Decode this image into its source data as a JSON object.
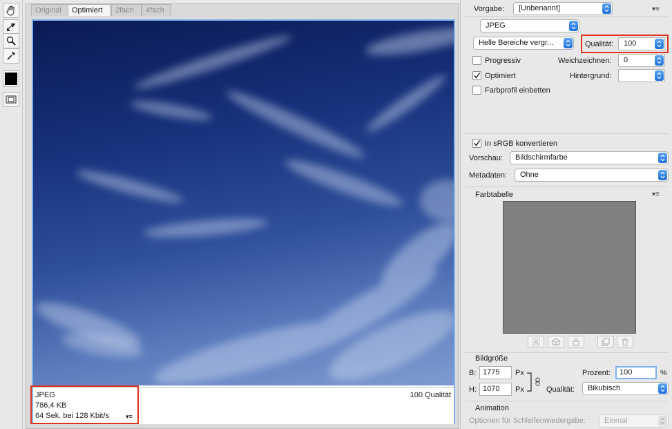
{
  "tabs": [
    "Original",
    "Optimiert",
    "2fach",
    "4fach"
  ],
  "info": {
    "format": "JPEG",
    "size": "786,4 KB",
    "download": "64 Sek. bei 128 Kbit/s",
    "quality": "100 Qualität"
  },
  "panel": {
    "vorgabe_label": "Vorgabe:",
    "vorgabe_value": "[Unbenannt]",
    "format_value": "JPEG",
    "preset_quality_value": "Helle Bereiche vergr...",
    "qualitaet_label": "Qualität:",
    "qualitaet_value": "100",
    "progressiv_label": "Progressiv",
    "optimiert_label": "Optimiert",
    "farbprofil_label": "Farbprofil einbetten",
    "weichzeichnen_label": "Weichzeichnen:",
    "weichzeichnen_value": "0",
    "hintergrund_label": "Hintergrund:",
    "hintergrund_value": "",
    "srgb_label": "In sRGB konvertieren",
    "vorschau_label": "Vorschau:",
    "vorschau_value": "Bildschirmfarbe",
    "metadaten_label": "Metadaten:",
    "metadaten_value": "Ohne",
    "farbtabelle_label": "Farbtabelle",
    "bildgroesse_label": "Bildgröße",
    "b_label": "B:",
    "b_value": "1775",
    "h_label": "H:",
    "h_value": "1070",
    "px_label": "Px",
    "prozent_label": "Prozent:",
    "prozent_value": "100",
    "percent_sign": "%",
    "qualitaet2_label": "Qualität:",
    "qualitaet2_value": "Bikubisch",
    "animation_label": "Animation",
    "schleife_label": "Optionen für Schleifenwiedergabe:",
    "schleife_value": "Einmal"
  },
  "states": {
    "progressiv": false,
    "optimiert": true,
    "farbprofil": false,
    "srgb": true
  },
  "colors": {
    "highlight": "#e0321c",
    "active_border": "#7db2f2",
    "color_table_fill": "#808080",
    "foreground_color": "#000000"
  }
}
